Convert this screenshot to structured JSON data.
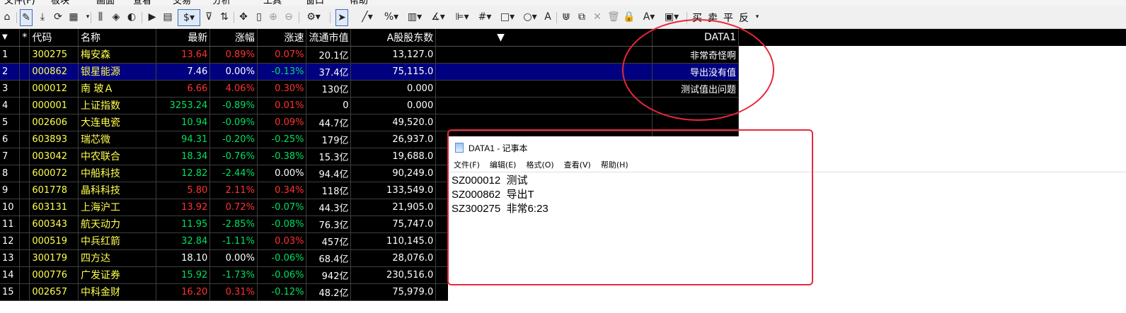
{
  "menubar": {
    "items": [
      "文件(F)",
      "板块",
      "画面",
      "查看",
      "交易",
      "分析",
      "工具",
      "窗口",
      "帮助"
    ]
  },
  "toolbar": {
    "trade_buttons": [
      "买",
      "卖",
      "平",
      "反"
    ]
  },
  "grid": {
    "columns": [
      "*",
      "代码",
      "名称",
      "最新",
      "涨幅",
      "涨速",
      "流通市值",
      "A股股东数",
      "▼",
      "DATA1"
    ],
    "selected_row": 2,
    "rows": [
      {
        "idx": "1",
        "code": "300275",
        "name": "梅安森",
        "price": "13.64",
        "chg": "0.89%",
        "speed": "0.07%",
        "mcap": "20.1亿",
        "holders": "13,127.0",
        "data1": "非常奇怪啊",
        "price_c": "up",
        "chg_c": "up",
        "speed_c": "up"
      },
      {
        "idx": "2",
        "code": "000862",
        "name": "银星能源",
        "price": "7.46",
        "chg": "0.00%",
        "speed": "-0.13%",
        "mcap": "37.4亿",
        "holders": "75,115.0",
        "data1": "导出没有值",
        "price_c": "wh",
        "chg_c": "wh",
        "speed_c": "dn"
      },
      {
        "idx": "3",
        "code": "000012",
        "name": "南 玻Ａ",
        "price": "6.66",
        "chg": "4.06%",
        "speed": "0.30%",
        "mcap": "130亿",
        "holders": "0.000",
        "data1": "测试值出问题",
        "price_c": "up",
        "chg_c": "up",
        "speed_c": "up"
      },
      {
        "idx": "4",
        "code": "000001",
        "name": "上证指数",
        "price": "3253.24",
        "chg": "-0.89%",
        "speed": "0.01%",
        "mcap": "0",
        "holders": "0.000",
        "data1": "",
        "price_c": "dn",
        "chg_c": "dn",
        "speed_c": "up"
      },
      {
        "idx": "5",
        "code": "002606",
        "name": "大连电瓷",
        "price": "10.94",
        "chg": "-0.09%",
        "speed": "0.09%",
        "mcap": "44.7亿",
        "holders": "49,520.0",
        "data1": "",
        "price_c": "dn",
        "chg_c": "dn",
        "speed_c": "up"
      },
      {
        "idx": "6",
        "code": "603893",
        "name": "瑞芯微",
        "price": "94.31",
        "chg": "-0.20%",
        "speed": "-0.25%",
        "mcap": "179亿",
        "holders": "26,937.0",
        "data1": "",
        "price_c": "dn",
        "chg_c": "dn",
        "speed_c": "dn"
      },
      {
        "idx": "7",
        "code": "003042",
        "name": "中农联合",
        "price": "18.34",
        "chg": "-0.76%",
        "speed": "-0.38%",
        "mcap": "15.3亿",
        "holders": "19,688.0",
        "data1": "",
        "price_c": "dn",
        "chg_c": "dn",
        "speed_c": "dn"
      },
      {
        "idx": "8",
        "code": "600072",
        "name": "中船科技",
        "price": "12.82",
        "chg": "-2.44%",
        "speed": "0.00%",
        "mcap": "94.4亿",
        "holders": "90,249.0",
        "data1": "",
        "price_c": "dn",
        "chg_c": "dn",
        "speed_c": "wh"
      },
      {
        "idx": "9",
        "code": "601778",
        "name": "晶科科技",
        "price": "5.80",
        "chg": "2.11%",
        "speed": "0.34%",
        "mcap": "118亿",
        "holders": "133,549.0",
        "data1": "",
        "price_c": "up",
        "chg_c": "up",
        "speed_c": "up"
      },
      {
        "idx": "10",
        "code": "603131",
        "name": "上海沪工",
        "price": "13.92",
        "chg": "0.72%",
        "speed": "-0.07%",
        "mcap": "44.3亿",
        "holders": "21,905.0",
        "data1": "",
        "price_c": "up",
        "chg_c": "up",
        "speed_c": "dn"
      },
      {
        "idx": "11",
        "code": "600343",
        "name": "航天动力",
        "price": "11.95",
        "chg": "-2.85%",
        "speed": "-0.08%",
        "mcap": "76.3亿",
        "holders": "75,747.0",
        "data1": "",
        "price_c": "dn",
        "chg_c": "dn",
        "speed_c": "dn"
      },
      {
        "idx": "12",
        "code": "000519",
        "name": "中兵红箭",
        "price": "32.84",
        "chg": "-1.11%",
        "speed": "0.03%",
        "mcap": "457亿",
        "holders": "110,145.0",
        "data1": "",
        "price_c": "dn",
        "chg_c": "dn",
        "speed_c": "up"
      },
      {
        "idx": "13",
        "code": "300179",
        "name": "四方达",
        "price": "18.10",
        "chg": "0.00%",
        "speed": "-0.06%",
        "mcap": "68.4亿",
        "holders": "28,076.0",
        "data1": "",
        "price_c": "wh",
        "chg_c": "wh",
        "speed_c": "dn"
      },
      {
        "idx": "14",
        "code": "000776",
        "name": "广发证券",
        "price": "15.92",
        "chg": "-1.73%",
        "speed": "-0.06%",
        "mcap": "942亿",
        "holders": "230,516.0",
        "data1": "",
        "price_c": "dn",
        "chg_c": "dn",
        "speed_c": "dn"
      },
      {
        "idx": "15",
        "code": "002657",
        "name": "中科金财",
        "price": "16.20",
        "chg": "0.31%",
        "speed": "-0.12%",
        "mcap": "48.2亿",
        "holders": "75,979.0",
        "data1": "",
        "price_c": "up",
        "chg_c": "up",
        "speed_c": "dn"
      }
    ]
  },
  "notepad": {
    "title": "DATA1 - 记事本",
    "menu": [
      "文件(F)",
      "编辑(E)",
      "格式(O)",
      "查看(V)",
      "帮助(H)"
    ],
    "lines": [
      "SZ000012  测试",
      "SZ000862  导出T",
      "SZ300275  非常6:23"
    ]
  },
  "colors": {
    "up": "#ff3232",
    "down": "#00e060",
    "flat": "#ffffff",
    "code": "#ffff50",
    "selected_row": "#000080",
    "annotation": "#e8283a"
  }
}
